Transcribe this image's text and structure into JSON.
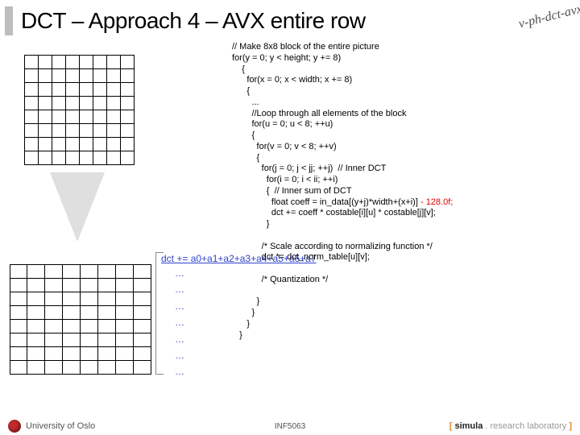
{
  "title": "DCT – Approach 4 – AVX entire row",
  "stamp": "v-ph-dct-avx",
  "code": {
    "l1": "// Make 8x8 block of the entire picture",
    "l2": "for(y = 0; y < height; y += 8)",
    "l3": "    {",
    "l4": "      for(x = 0; x < width; x += 8)",
    "l5": "      {",
    "l6": "        ...",
    "l7": "        //Loop through all elements of the block",
    "l8": "        for(u = 0; u < 8; ++u)",
    "l9": "        {",
    "l10": "          for(v = 0; v < 8; ++v)",
    "l11": "          {",
    "l12": "            for(j = 0; j < jj; ++j)  // Inner DCT",
    "l13": "              for(i = 0; i < ii; ++i)",
    "l14": "              {  // Inner sum of DCT",
    "l15": "                float coeff = in_data[(y+j)*width+(x+i)] ",
    "l15b": "- 128.0f;",
    "l16": "                dct += coeff * costable[i][u] * costable[j][v];",
    "l17": "              }",
    "l18": "",
    "l19": "            /* Scale according to normalizing function */",
    "l20": "            dct *= dct_norm_table[u][v];",
    "l21": "",
    "l22": "            /* Quantization */",
    "l23": "",
    "l24": "          }",
    "l25": "        }",
    "l26": "      }",
    "l27": "   }"
  },
  "accum": "dct += a0+a1+a2+a3+a4+a5+a6+a7",
  "footer": {
    "uni": "University of Oslo",
    "mid": "INF5063",
    "simula_open": "[ ",
    "simula_brand": "simula",
    "simula_rest": " . research laboratory ",
    "simula_close": "]"
  }
}
